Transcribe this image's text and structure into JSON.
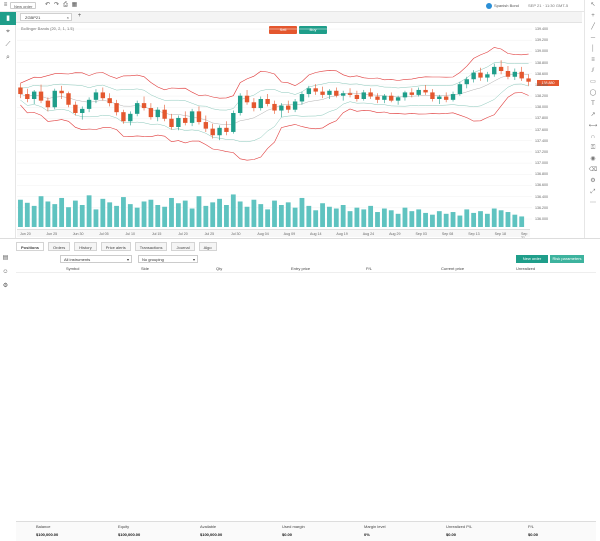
{
  "topbar": {
    "menu_label": "New order",
    "instrument": "Spanish Bond",
    "time_label": "SEP 21 · 11:30 GMT-5",
    "ticker_chip": "ZGBP21"
  },
  "chart": {
    "label": "Bollinger Bands (20, 2, 1, 1.5)",
    "sell_button": "Sell",
    "buy_button": "Buy",
    "price_tag": "138.880",
    "y_ticks": [
      "139.400",
      "139.200",
      "139.000",
      "138.800",
      "138.600",
      "138.400",
      "138.200",
      "138.000",
      "137.800",
      "137.600",
      "137.400",
      "137.200",
      "137.000",
      "136.800",
      "136.600",
      "136.400",
      "136.200",
      "136.000"
    ],
    "x_ticks": [
      "Jun 20",
      "Jun 25",
      "Jun 30",
      "Jul 05",
      "Jul 10",
      "Jul 15",
      "Jul 20",
      "Jul 25",
      "Jul 30",
      "Aug 04",
      "Aug 09",
      "Aug 14",
      "Aug 19",
      "Aug 24",
      "Aug 29",
      "Sep 03",
      "Sep 08",
      "Sep 13",
      "Sep 18",
      "Sep 21"
    ],
    "colors": {
      "up": "#1f9e8a",
      "down": "#e4572e",
      "band_outer": "#e03b3b",
      "band_mid": "#b0b0b0",
      "band_inner": "#88c7b9",
      "volume": "#5fc3c0"
    },
    "candles": [
      {
        "o": 137.98,
        "h": 138.08,
        "l": 137.72,
        "c": 137.82
      },
      {
        "o": 137.82,
        "h": 137.95,
        "l": 137.62,
        "c": 137.7
      },
      {
        "o": 137.7,
        "h": 137.92,
        "l": 137.58,
        "c": 137.88
      },
      {
        "o": 137.88,
        "h": 138.05,
        "l": 137.6,
        "c": 137.66
      },
      {
        "o": 137.66,
        "h": 137.74,
        "l": 137.4,
        "c": 137.5
      },
      {
        "o": 137.5,
        "h": 137.95,
        "l": 137.45,
        "c": 137.9
      },
      {
        "o": 137.9,
        "h": 138.02,
        "l": 137.7,
        "c": 137.84
      },
      {
        "o": 137.84,
        "h": 137.88,
        "l": 137.5,
        "c": 137.56
      },
      {
        "o": 137.56,
        "h": 137.64,
        "l": 137.3,
        "c": 137.36
      },
      {
        "o": 137.36,
        "h": 137.52,
        "l": 137.2,
        "c": 137.46
      },
      {
        "o": 137.46,
        "h": 137.74,
        "l": 137.38,
        "c": 137.68
      },
      {
        "o": 137.68,
        "h": 137.94,
        "l": 137.6,
        "c": 137.86
      },
      {
        "o": 137.86,
        "h": 137.98,
        "l": 137.66,
        "c": 137.72
      },
      {
        "o": 137.72,
        "h": 137.84,
        "l": 137.52,
        "c": 137.6
      },
      {
        "o": 137.6,
        "h": 137.68,
        "l": 137.3,
        "c": 137.38
      },
      {
        "o": 137.38,
        "h": 137.44,
        "l": 137.1,
        "c": 137.16
      },
      {
        "o": 137.16,
        "h": 137.4,
        "l": 137.06,
        "c": 137.34
      },
      {
        "o": 137.34,
        "h": 137.66,
        "l": 137.28,
        "c": 137.6
      },
      {
        "o": 137.6,
        "h": 137.76,
        "l": 137.42,
        "c": 137.48
      },
      {
        "o": 137.48,
        "h": 137.6,
        "l": 137.2,
        "c": 137.26
      },
      {
        "o": 137.26,
        "h": 137.5,
        "l": 137.16,
        "c": 137.44
      },
      {
        "o": 137.44,
        "h": 137.56,
        "l": 137.16,
        "c": 137.22
      },
      {
        "o": 137.22,
        "h": 137.34,
        "l": 136.96,
        "c": 137.02
      },
      {
        "o": 137.02,
        "h": 137.3,
        "l": 136.94,
        "c": 137.24
      },
      {
        "o": 137.24,
        "h": 137.4,
        "l": 137.06,
        "c": 137.12
      },
      {
        "o": 137.12,
        "h": 137.46,
        "l": 137.04,
        "c": 137.4
      },
      {
        "o": 137.4,
        "h": 137.52,
        "l": 137.08,
        "c": 137.14
      },
      {
        "o": 137.14,
        "h": 137.3,
        "l": 136.9,
        "c": 136.98
      },
      {
        "o": 136.98,
        "h": 137.1,
        "l": 136.74,
        "c": 136.82
      },
      {
        "o": 136.82,
        "h": 137.06,
        "l": 136.7,
        "c": 137.0
      },
      {
        "o": 137.0,
        "h": 137.16,
        "l": 136.82,
        "c": 136.9
      },
      {
        "o": 136.9,
        "h": 137.42,
        "l": 136.86,
        "c": 137.36
      },
      {
        "o": 137.36,
        "h": 137.84,
        "l": 137.3,
        "c": 137.78
      },
      {
        "o": 137.78,
        "h": 137.92,
        "l": 137.56,
        "c": 137.62
      },
      {
        "o": 137.62,
        "h": 137.72,
        "l": 137.4,
        "c": 137.48
      },
      {
        "o": 137.48,
        "h": 137.76,
        "l": 137.42,
        "c": 137.7
      },
      {
        "o": 137.7,
        "h": 137.82,
        "l": 137.52,
        "c": 137.58
      },
      {
        "o": 137.58,
        "h": 137.66,
        "l": 137.34,
        "c": 137.42
      },
      {
        "o": 137.42,
        "h": 137.6,
        "l": 137.26,
        "c": 137.54
      },
      {
        "o": 137.54,
        "h": 137.66,
        "l": 137.36,
        "c": 137.44
      },
      {
        "o": 137.44,
        "h": 137.7,
        "l": 137.38,
        "c": 137.64
      },
      {
        "o": 137.64,
        "h": 137.88,
        "l": 137.56,
        "c": 137.82
      },
      {
        "o": 137.82,
        "h": 138.02,
        "l": 137.74,
        "c": 137.96
      },
      {
        "o": 137.96,
        "h": 138.06,
        "l": 137.8,
        "c": 137.88
      },
      {
        "o": 137.88,
        "h": 138.0,
        "l": 137.72,
        "c": 137.8
      },
      {
        "o": 137.8,
        "h": 137.94,
        "l": 137.7,
        "c": 137.9
      },
      {
        "o": 137.9,
        "h": 137.98,
        "l": 137.74,
        "c": 137.78
      },
      {
        "o": 137.78,
        "h": 137.9,
        "l": 137.66,
        "c": 137.84
      },
      {
        "o": 137.84,
        "h": 137.96,
        "l": 137.74,
        "c": 137.8
      },
      {
        "o": 137.8,
        "h": 137.9,
        "l": 137.64,
        "c": 137.7
      },
      {
        "o": 137.7,
        "h": 137.92,
        "l": 137.66,
        "c": 137.86
      },
      {
        "o": 137.86,
        "h": 137.96,
        "l": 137.7,
        "c": 137.76
      },
      {
        "o": 137.76,
        "h": 137.84,
        "l": 137.6,
        "c": 137.68
      },
      {
        "o": 137.68,
        "h": 137.82,
        "l": 137.6,
        "c": 137.78
      },
      {
        "o": 137.78,
        "h": 137.86,
        "l": 137.62,
        "c": 137.66
      },
      {
        "o": 137.66,
        "h": 137.78,
        "l": 137.56,
        "c": 137.74
      },
      {
        "o": 137.74,
        "h": 137.9,
        "l": 137.66,
        "c": 137.86
      },
      {
        "o": 137.86,
        "h": 137.96,
        "l": 137.74,
        "c": 137.8
      },
      {
        "o": 137.8,
        "h": 137.98,
        "l": 137.76,
        "c": 137.92
      },
      {
        "o": 137.92,
        "h": 138.04,
        "l": 137.8,
        "c": 137.86
      },
      {
        "o": 137.86,
        "h": 137.94,
        "l": 137.64,
        "c": 137.7
      },
      {
        "o": 137.7,
        "h": 137.8,
        "l": 137.58,
        "c": 137.76
      },
      {
        "o": 137.76,
        "h": 137.86,
        "l": 137.62,
        "c": 137.68
      },
      {
        "o": 137.68,
        "h": 137.88,
        "l": 137.64,
        "c": 137.82
      },
      {
        "o": 137.82,
        "h": 138.12,
        "l": 137.78,
        "c": 138.06
      },
      {
        "o": 138.06,
        "h": 138.24,
        "l": 137.96,
        "c": 138.18
      },
      {
        "o": 138.18,
        "h": 138.4,
        "l": 138.1,
        "c": 138.34
      },
      {
        "o": 138.34,
        "h": 138.46,
        "l": 138.14,
        "c": 138.22
      },
      {
        "o": 138.22,
        "h": 138.36,
        "l": 138.12,
        "c": 138.3
      },
      {
        "o": 138.3,
        "h": 138.56,
        "l": 138.24,
        "c": 138.48
      },
      {
        "o": 138.48,
        "h": 138.64,
        "l": 138.3,
        "c": 138.38
      },
      {
        "o": 138.38,
        "h": 138.5,
        "l": 138.18,
        "c": 138.24
      },
      {
        "o": 138.24,
        "h": 138.44,
        "l": 138.16,
        "c": 138.36
      },
      {
        "o": 138.36,
        "h": 138.48,
        "l": 138.14,
        "c": 138.2
      },
      {
        "o": 138.2,
        "h": 138.3,
        "l": 138.02,
        "c": 138.12
      }
    ],
    "volume": [
      0.62,
      0.55,
      0.48,
      0.7,
      0.58,
      0.52,
      0.66,
      0.45,
      0.6,
      0.5,
      0.72,
      0.4,
      0.64,
      0.56,
      0.48,
      0.68,
      0.52,
      0.44,
      0.58,
      0.62,
      0.5,
      0.46,
      0.66,
      0.54,
      0.6,
      0.42,
      0.7,
      0.48,
      0.56,
      0.64,
      0.5,
      0.74,
      0.58,
      0.46,
      0.62,
      0.52,
      0.4,
      0.6,
      0.5,
      0.56,
      0.44,
      0.66,
      0.48,
      0.38,
      0.54,
      0.46,
      0.42,
      0.5,
      0.36,
      0.44,
      0.4,
      0.48,
      0.34,
      0.42,
      0.38,
      0.3,
      0.44,
      0.36,
      0.4,
      0.32,
      0.28,
      0.36,
      0.3,
      0.34,
      0.26,
      0.4,
      0.32,
      0.36,
      0.3,
      0.42,
      0.38,
      0.34,
      0.28,
      0.24
    ]
  },
  "bottom": {
    "tabs": [
      "Positions",
      "Orders",
      "History",
      "Price alerts",
      "Transactions",
      "Journal",
      "Algo"
    ],
    "filter1": "All instruments",
    "filter2": "No grouping",
    "new_order": "New order",
    "account_button": "Risk parameters",
    "headers": [
      "Symbol",
      "Side",
      "Qty",
      "Entry price",
      "P/L",
      "Current price",
      "Unrealized"
    ],
    "summary_labels": [
      "Balance",
      "Equity",
      "Available",
      "Used margin",
      "Margin level",
      "Unrealized P/L",
      "P/L"
    ],
    "summary_values": [
      "$100,000.00",
      "$100,000.00",
      "$100,000.00",
      "$0.00",
      "0%",
      "$0.00",
      "$0.00"
    ]
  }
}
